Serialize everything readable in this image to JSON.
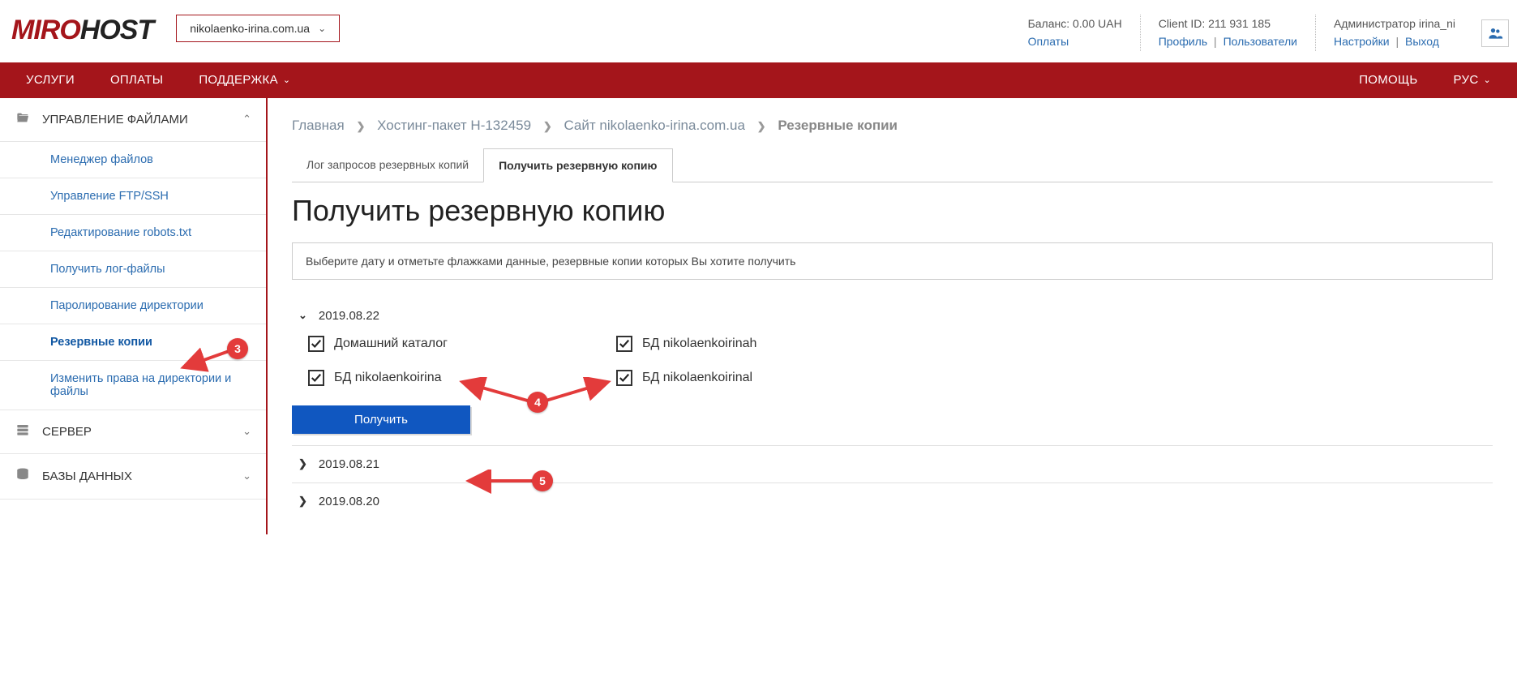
{
  "header": {
    "logo_miro": "MIRO",
    "logo_host": "HOST",
    "domain": "nikolaenko-irina.com.ua",
    "balance_label": "Баланс: 0.00 UAH",
    "payments": "Оплаты",
    "client_id_label": "Client ID: 211 931 185",
    "profile": "Профиль",
    "users": "Пользователи",
    "admin_label": "Администратор irina_ni",
    "settings": "Настройки",
    "logout": "Выход"
  },
  "nav": {
    "services": "УСЛУГИ",
    "payments": "ОПЛАТЫ",
    "support": "ПОДДЕРЖКА",
    "help": "ПОМОЩЬ",
    "lang": "РУС"
  },
  "sidebar": {
    "cat_files": "УПРАВЛЕНИЕ ФАЙЛАМИ",
    "sub_fm": "Менеджер файлов",
    "sub_ftp": "Управление FTP/SSH",
    "sub_robots": "Редактирование robots.txt",
    "sub_logs": "Получить лог-файлы",
    "sub_passwd": "Паролирование директории",
    "sub_backup": "Резервные копии",
    "sub_perm": "Изменить права на директории и файлы",
    "cat_server": "СЕРВЕР",
    "cat_db": "БАЗЫ ДАННЫХ"
  },
  "breadcrumb": {
    "home": "Главная",
    "pkg": "Хостинг-пакет H-132459",
    "site": "Сайт nikolaenko-irina.com.ua",
    "current": "Резервные копии"
  },
  "tabs": {
    "log": "Лог запросов резервных копий",
    "get": "Получить резервную копию"
  },
  "page": {
    "title": "Получить резервную копию",
    "info": "Выберите дату и отметьте флажками данные, резервные копии которых Вы хотите получить",
    "get_button": "Получить"
  },
  "dates": {
    "d0": {
      "label": "2019.08.22",
      "items": {
        "i0": "Домашний каталог",
        "i1": "БД nikolaenkoirinah",
        "i2": "БД nikolaenkoirina",
        "i3": "БД nikolaenkoirinal"
      }
    },
    "d1": {
      "label": "2019.08.21"
    },
    "d2": {
      "label": "2019.08.20"
    }
  },
  "anno": {
    "b3": "3",
    "b4": "4",
    "b5": "5"
  }
}
